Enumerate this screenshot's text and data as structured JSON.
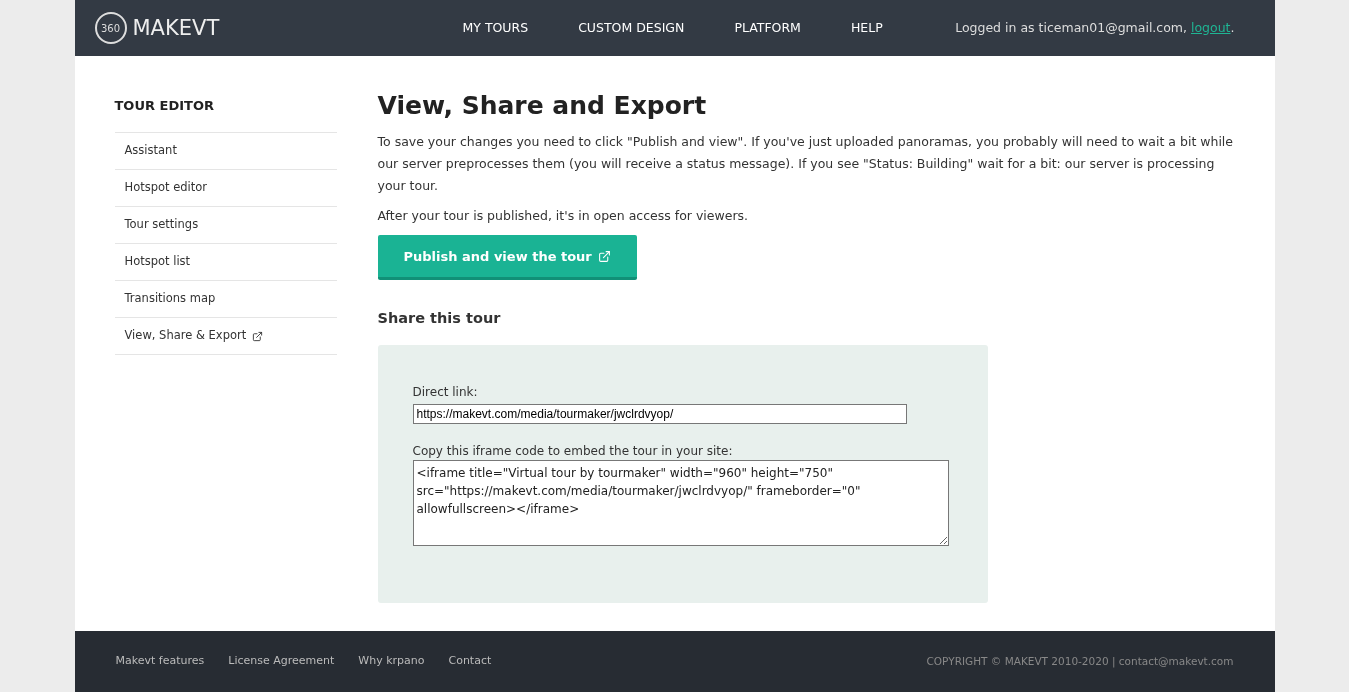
{
  "header": {
    "logo_badge": "360",
    "logo_text": "MAKEVT",
    "nav": [
      "MY TOURS",
      "CUSTOM DESIGN",
      "PLATFORM",
      "HELP"
    ],
    "login_prefix": "Logged in as ticeman01@gmail.com, ",
    "logout_link": "logout",
    "login_suffix": "."
  },
  "sidebar": {
    "title": "TOUR EDITOR",
    "items": [
      {
        "label": "Assistant",
        "external": false
      },
      {
        "label": "Hotspot editor",
        "external": false
      },
      {
        "label": "Tour settings",
        "external": false
      },
      {
        "label": "Hotspot list",
        "external": false
      },
      {
        "label": "Transitions map",
        "external": false
      },
      {
        "label": "View, Share & Export",
        "external": true
      }
    ]
  },
  "content": {
    "title": "View, Share and Export",
    "paragraphs": [
      "To save your changes you need to click \"Publish and view\". If you've just uploaded panoramas, you probably will need to wait a bit while our server preprocesses them (you will receive a status message). If you see \"Status: Building\" wait for a bit: our server is processing your tour.",
      "After your tour is published, it's in open access for viewers."
    ],
    "publish_button": "Publish and view the tour",
    "share_title": "Share this tour",
    "direct_link_label": "Direct link:",
    "direct_link_value": "https://makevt.com/media/tourmaker/jwclrdvyop/",
    "iframe_label": "Copy this iframe code to embed the tour in your site:",
    "iframe_value": "<iframe title=\"Virtual tour by tourmaker\" width=\"960\" height=\"750\" src=\"https://makevt.com/media/tourmaker/jwclrdvyop/\" frameborder=\"0\" allowfullscreen></iframe>"
  },
  "footer": {
    "links": [
      "Makevt features",
      "License Agreement",
      "Why krpano",
      "Contact"
    ],
    "copyright": "COPYRIGHT © MAKEVT 2010-2020 | contact@makevt.com"
  }
}
